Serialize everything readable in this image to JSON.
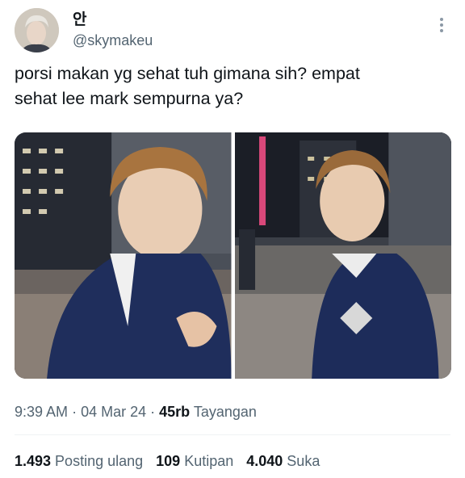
{
  "author": {
    "display_name": "안",
    "handle": "@skymakeu"
  },
  "tweet": {
    "text_line1": "porsi makan yg sehat tuh gimana sih? empat",
    "text_line2": "sehat lee mark sempurna ya?"
  },
  "meta": {
    "time": "9:39 AM",
    "date": "04 Mar 24",
    "views_count": "45rb",
    "views_label": "Tayangan"
  },
  "stats": {
    "reposts_count": "1.493",
    "reposts_label": "Posting ulang",
    "quotes_count": "109",
    "quotes_label": "Kutipan",
    "likes_count": "4.040",
    "likes_label": "Suka"
  }
}
